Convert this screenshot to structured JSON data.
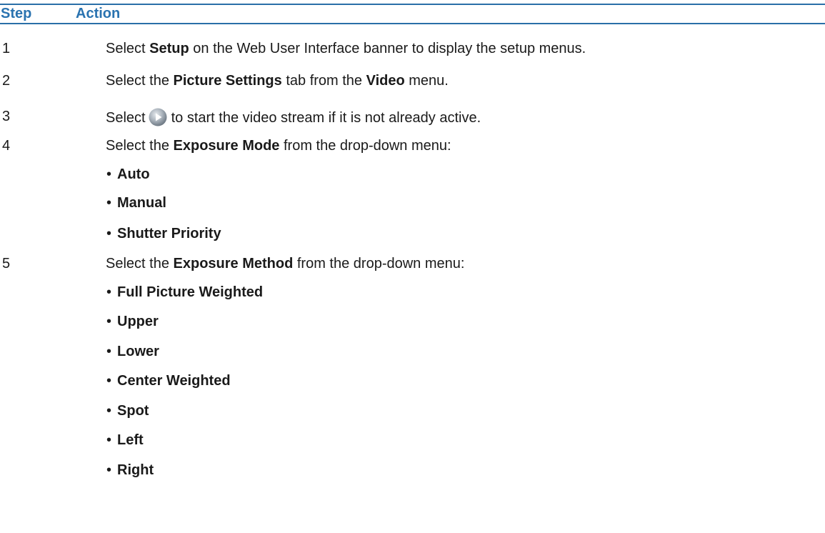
{
  "header": {
    "step": "Step",
    "action": "Action"
  },
  "steps": [
    {
      "num": "1",
      "parts": [
        "Select ",
        "Setup",
        " on the Web User Interface banner to display the setup menus."
      ]
    },
    {
      "num": "2",
      "parts": [
        "Select the ",
        "Picture Settings",
        " tab from the ",
        "Video",
        " menu."
      ]
    },
    {
      "num": "3",
      "icon": "play-button-icon",
      "parts": [
        "Select",
        "to start the video stream if it is not already active."
      ]
    },
    {
      "num": "4",
      "parts": [
        "Select the ",
        "Exposure Mode",
        " from the drop-down menu:"
      ],
      "bullets": [
        "Auto",
        "Manual",
        "Shutter Priority"
      ]
    },
    {
      "num": "5",
      "parts": [
        "Select the ",
        "Exposure Method",
        " from the drop-down menu:"
      ],
      "bullets": [
        "Full Picture Weighted",
        "Upper",
        "Lower",
        "Center Weighted",
        "Spot",
        "Left",
        "Right"
      ]
    }
  ],
  "bullet_glyph": "•",
  "colors": {
    "header_text": "#2a73b0",
    "rule": "#2a6fa8"
  }
}
